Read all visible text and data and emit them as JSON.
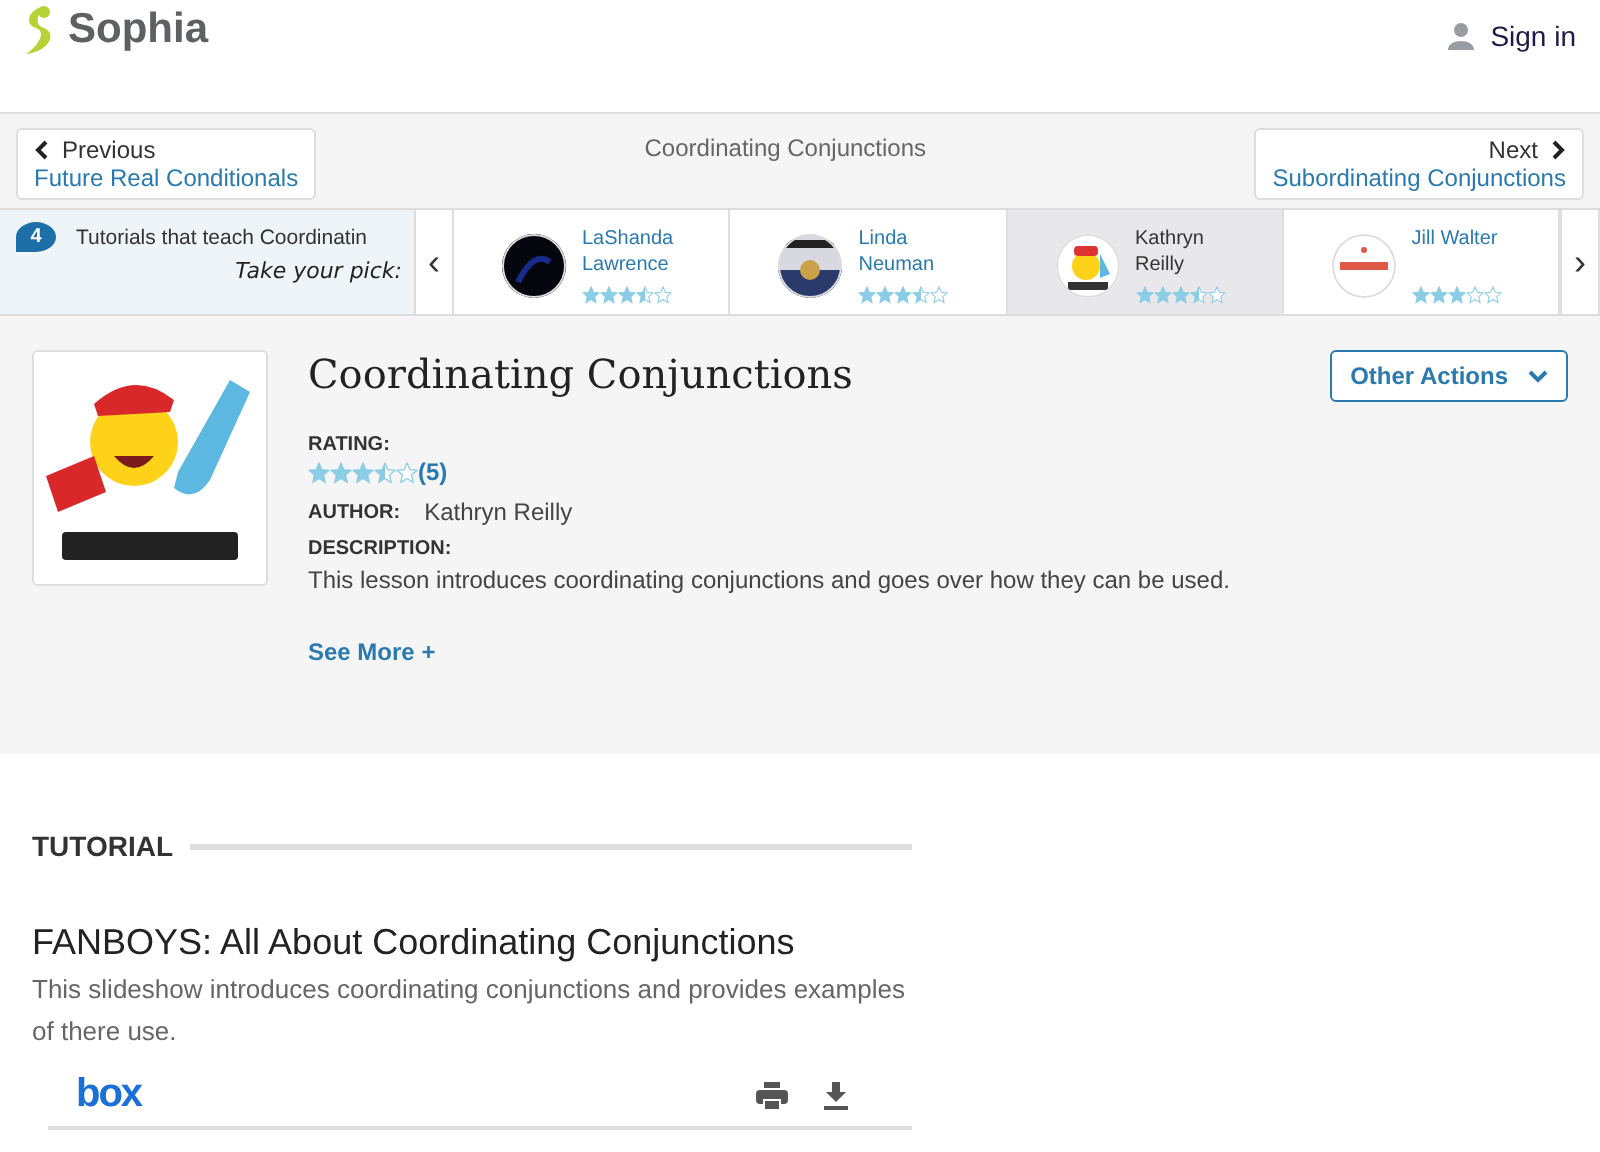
{
  "header": {
    "logo": "Sophia",
    "sign_in": "Sign in"
  },
  "nav": {
    "previous": {
      "label": "Previous",
      "title": "Future Real Conditionals"
    },
    "current": "Coordinating Conjunctions",
    "next": {
      "label": "Next",
      "title": "Subordinating Conjunctions"
    }
  },
  "carousel": {
    "count": "4",
    "heading": "Tutorials that teach Coordinatin",
    "tagline": "Take your pick:",
    "left_arrow": "‹",
    "right_arrow": "›",
    "tutors": [
      {
        "name": "LaShanda Lawrence",
        "stars": 3.5,
        "selected": false
      },
      {
        "name": "Linda Neuman",
        "stars": 3.5,
        "selected": false
      },
      {
        "name": "Kathryn Reilly",
        "stars": 3.5,
        "selected": true
      },
      {
        "name": "Jill Walter",
        "stars": 3,
        "selected": false
      }
    ]
  },
  "lesson": {
    "title": "Coordinating Conjunctions",
    "other_actions": "Other Actions",
    "rating_label": "RATING:",
    "stars": 3.5,
    "rating_count": "(5)",
    "author_label": "AUTHOR:",
    "author": "Kathryn Reilly",
    "description_label": "DESCRIPTION:",
    "description": "This lesson introduces coordinating conjunctions and goes over how they can be used.",
    "see_more": "See More +"
  },
  "tutorial": {
    "section": "TUTORIAL",
    "title": "FANBOYS: All About Coordinating Conjunctions",
    "description": "This slideshow introduces coordinating conjunctions and provides examples of there use.",
    "viewer_logo": "box"
  }
}
